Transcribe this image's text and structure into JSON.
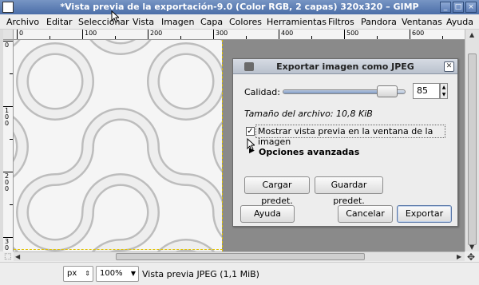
{
  "window": {
    "title": "*Vista previa de la exportación-9.0 (Color RGB, 2 capas) 320x320 – GIMP",
    "controls": [
      "_",
      "□",
      "×"
    ]
  },
  "menubar": {
    "items": [
      "Archivo",
      "Editar",
      "Seleccionar",
      "Vista",
      "Imagen",
      "Capa",
      "Colores",
      "Herramientas",
      "Filtros",
      "Pandora",
      "Ventanas",
      "Ayuda"
    ]
  },
  "rulers": {
    "top_labels": [
      "0",
      "100",
      "200",
      "300",
      "400",
      "500",
      "600"
    ],
    "left_labels": [
      "0",
      "100",
      "200",
      "300"
    ]
  },
  "statusbar": {
    "unit": "px",
    "zoom": "100%",
    "message": "Vista previa JPEG (1,1 MiB)"
  },
  "dialog": {
    "title": "Exportar imagen como JPEG",
    "quality_label": "Calidad:",
    "quality_value": "85",
    "quality_fraction": 0.85,
    "filesize": "Tamaño del archivo: 10,8 KiB",
    "preview_checkbox_label": "Mostrar vista previa en la ventana de la imagen",
    "preview_checked": true,
    "advanced_label": "Opciones avanzadas",
    "load_defaults": "Cargar predet.",
    "save_defaults": "Guardar predet.",
    "help": "Ayuda",
    "cancel": "Cancelar",
    "export": "Exportar"
  },
  "colors": {
    "titlebar": "#5a7cb4",
    "dialog_titlebar": "#c3cad5",
    "canvas_bg": "#8a8a8a",
    "image_bg": "#f3f3f3",
    "selection_border": "#e0c000"
  }
}
